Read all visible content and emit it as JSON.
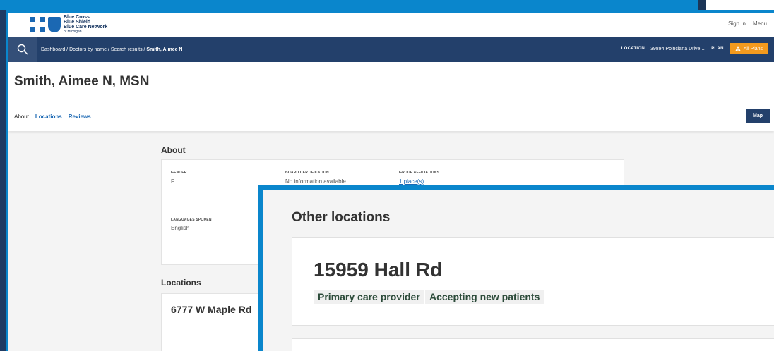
{
  "header": {
    "logo_line1": "Blue Cross",
    "logo_line2": "Blue Shield",
    "logo_line3": "Blue Care Network",
    "logo_line4": "of Michigan",
    "sign_in": "Sign In",
    "menu": "Menu"
  },
  "navbar": {
    "breadcrumb": "Dashboard / Doctors by name / Search results / ",
    "breadcrumb_current": "Smith, Aimee N",
    "location_label": "LOCATION",
    "location_value": "39894 Poinciana Drive....",
    "plan_label": "PLAN",
    "plans_button": "All Plans"
  },
  "profile": {
    "name": "Smith, Aimee N, MSN"
  },
  "tabs": {
    "about": "About",
    "locations": "Locations",
    "reviews": "Reviews",
    "map_button": "Map"
  },
  "about": {
    "title": "About",
    "gender_label": "GENDER",
    "gender_value": "F",
    "board_label": "BOARD CERTIFICATION",
    "board_value": "No information available",
    "group_label": "GROUP AFFILIATIONS",
    "group_value": "1 place(s)",
    "languages_label": "LANGUAGES SPOKEN",
    "languages_value": "English"
  },
  "locations": {
    "title": "Locations",
    "first_street": "6777 W Maple Rd"
  },
  "zoom": {
    "title": "Other locations",
    "street": "15959 Hall Rd",
    "tag1": "Primary care provider",
    "tag2": "Accepting new patients"
  },
  "colors": {
    "brand_blue": "#0a86cc",
    "navy": "#23406b",
    "orange": "#f39a1e"
  }
}
